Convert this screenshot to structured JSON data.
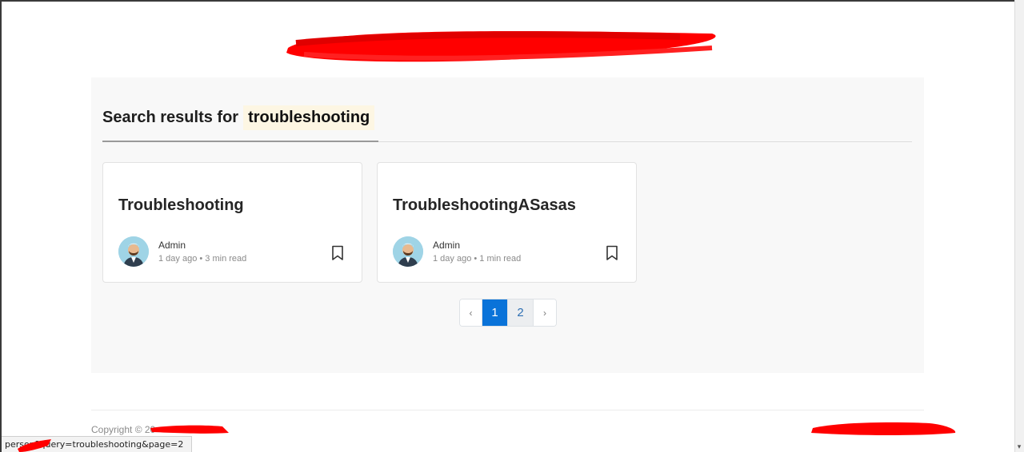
{
  "search": {
    "prefix": "Search results for",
    "query": "troubleshooting"
  },
  "results": [
    {
      "title": "Troubleshooting",
      "author": "Admin",
      "meta": "1 day ago • 3 min read"
    },
    {
      "title": "TroubleshootingASasas",
      "author": "Admin",
      "meta": "1 day ago • 1 min read"
    }
  ],
  "pagination": {
    "prev": "‹",
    "pages": [
      "1",
      "2"
    ],
    "current": "1",
    "next": "›"
  },
  "footer": {
    "copyright": "Copyright © 20"
  },
  "status_bar": {
    "url_fragment": "person",
    "url_text": "?query=troubleshooting&page=2"
  },
  "colors": {
    "accent": "#0a73d9",
    "redaction": "#ff0000",
    "panel_bg": "#f8f8f8",
    "query_highlight": "#fdf6e3"
  },
  "icons": {
    "bookmark": "bookmark-icon",
    "avatar": "avatar-illustration"
  }
}
